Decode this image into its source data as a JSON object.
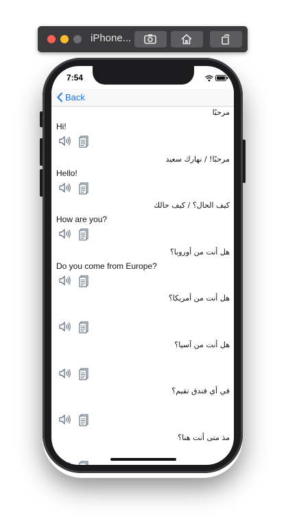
{
  "simulator": {
    "title": "iPhone...",
    "buttons": [
      "screenshot",
      "home",
      "rotate"
    ]
  },
  "status_bar": {
    "time": "7:54"
  },
  "nav": {
    "back_label": "Back"
  },
  "phrases": [
    {
      "arabic": "مرحبًا",
      "english": "Hi!"
    },
    {
      "arabic": "مرحبًا! / نهارك سعيد",
      "english": "Hello!"
    },
    {
      "arabic": "كيف الحال؟ / كيف حالك",
      "english": "How are you?"
    },
    {
      "arabic": "هل أنت من أوروبا؟",
      "english": "Do you come from Europe?"
    },
    {
      "arabic": "هل أنت من أمريكا؟",
      "english": ""
    },
    {
      "arabic": "هل أنت من آسيا؟",
      "english": ""
    },
    {
      "arabic": "في أي فندق تقيم؟",
      "english": ""
    },
    {
      "arabic": "مذ متى أنت هنا؟",
      "english": ""
    }
  ],
  "colors": {
    "accent": "#1a73e8",
    "icon": "#5a6a7a"
  }
}
